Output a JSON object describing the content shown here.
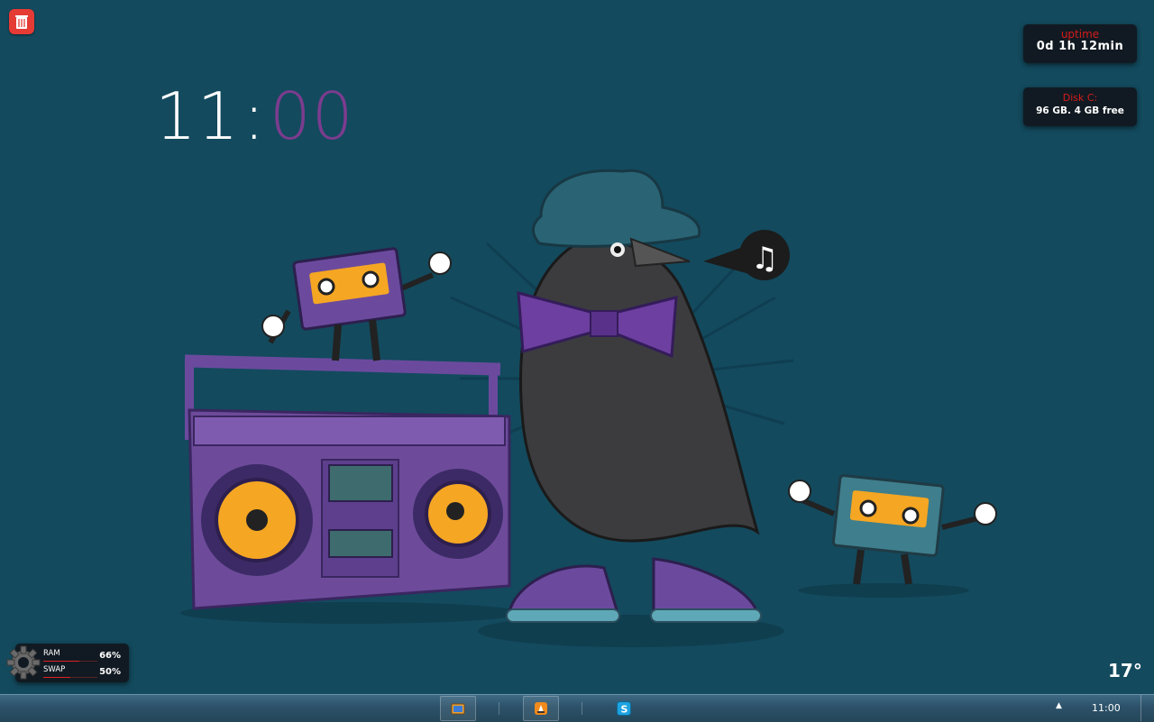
{
  "clock": {
    "hours": "11",
    "separator": ":",
    "minutes": "00"
  },
  "widgets": {
    "uptime": {
      "title": "uptime",
      "value": "0d 1h 12min"
    },
    "disk": {
      "title": "Disk C:",
      "value": "96 GB. 4 GB free"
    }
  },
  "system_monitor": {
    "ram": {
      "label": "RAM",
      "percent_text": "66%",
      "percent": 66
    },
    "swap": {
      "label": "SWAP",
      "percent_text": "50%",
      "percent": 50
    }
  },
  "weather": {
    "temperature": "17°"
  },
  "desktop_icons": [
    {
      "name": "recycle-bin-icon"
    }
  ],
  "taskbar": {
    "pinned": [
      "explorer-icon",
      "vlc-icon",
      "skype-icon"
    ],
    "tray_arrow": "▲",
    "time": "11:00"
  },
  "colors": {
    "desktop": "#134a5e",
    "clock_minutes": "#7b3c8e",
    "widget_bg": "#111a22",
    "widget_title": "#d51b1b"
  }
}
